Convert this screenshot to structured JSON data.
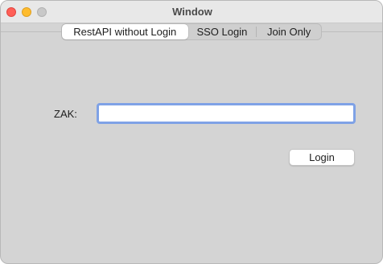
{
  "window": {
    "title": "Window"
  },
  "tabs": [
    {
      "label": "RestAPI without Login",
      "selected": true
    },
    {
      "label": "SSO Login",
      "selected": false
    },
    {
      "label": "Join Only",
      "selected": false
    }
  ],
  "form": {
    "zak_label": "ZAK:",
    "zak_value": "",
    "login_label": "Login"
  },
  "colors": {
    "close": "#ff5f57",
    "minimize": "#febc2e",
    "zoom": "#c8c8c8",
    "focus_ring": "#7fa2e6",
    "background": "#d4d4d4"
  }
}
